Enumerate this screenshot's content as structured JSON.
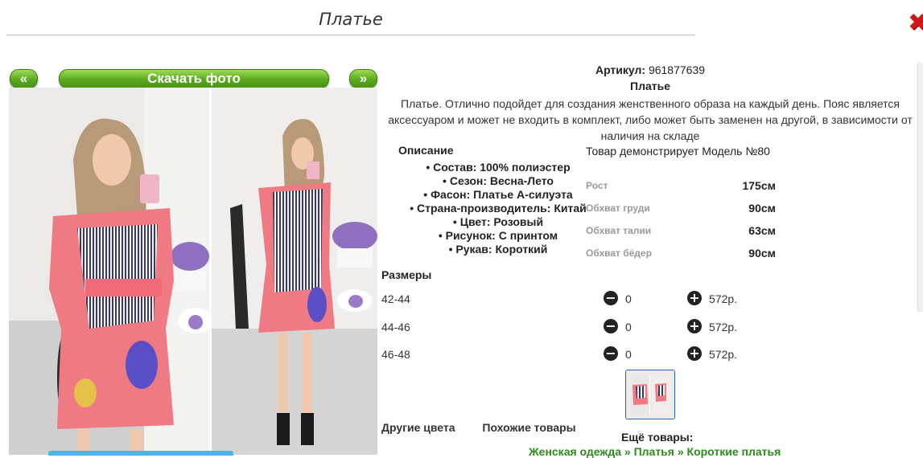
{
  "page": {
    "title": "Платье"
  },
  "gallery": {
    "prev_label": "«",
    "next_label": "»",
    "download_label": "Скачать фото"
  },
  "product": {
    "article_label": "Артикул:",
    "article_value": "961877639",
    "name": "Платье",
    "description": "Платье. Отлично подойдет для создания женственного образа на каждый день. Пояс является аксессуаром и может не входить в комплект, либо может быть заменен на другой, в зависимости от наличия на складе",
    "specs_heading": "Описание",
    "specs": [
      "Состав: 100% полиэстер",
      "Сезон: Весна-Лето",
      "Фасон: Платье А-силуэта",
      "Страна-производитель: Китай",
      "Цвет: Розовый",
      "Рисунок: С принтом",
      "Рукав: Короткий"
    ],
    "model_heading": "Товар демонстрирует Модель №80",
    "measurements": [
      {
        "label": "Рост",
        "value": "175см"
      },
      {
        "label": "Обхват груди",
        "value": "90см"
      },
      {
        "label": "Обхват талии",
        "value": "63см"
      },
      {
        "label": "Обхват бёдер",
        "value": "90см"
      }
    ]
  },
  "sizes": {
    "heading": "Размеры",
    "rows": [
      {
        "size": "42-44",
        "qty": "0",
        "price": "572р."
      },
      {
        "size": "44-46",
        "qty": "0",
        "price": "572р."
      },
      {
        "size": "46-48",
        "qty": "0",
        "price": "572р."
      }
    ],
    "minus_icon": "minus-circle-icon",
    "plus_icon": "plus-circle-icon"
  },
  "tabs": {
    "other_colors": "Другие цвета",
    "similar": "Похожие товары"
  },
  "more": {
    "heading": "Ещё товары:",
    "crumbs": [
      "Женская одежда",
      "Платья",
      "Короткие платья"
    ],
    "separator": "»"
  },
  "colors": {
    "accent_green": "#5aa91f",
    "link_green": "#2e8b1e",
    "close_red": "#d01818"
  }
}
